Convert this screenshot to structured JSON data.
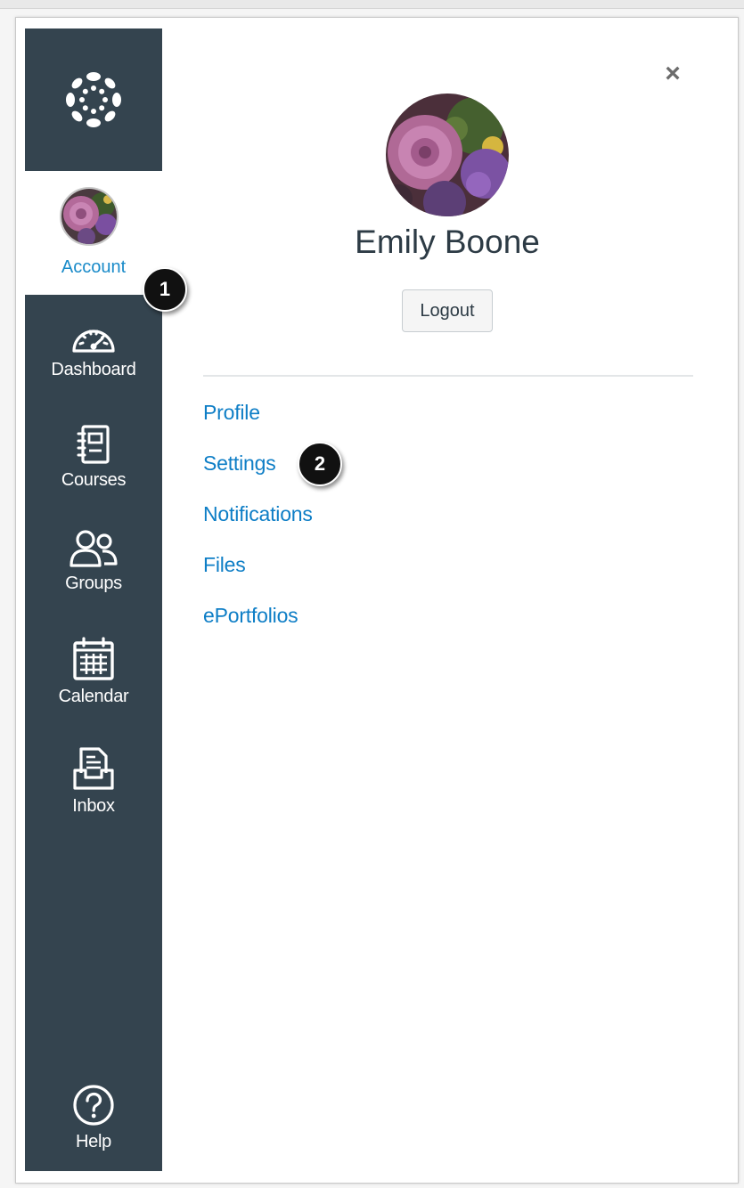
{
  "nav": {
    "account_label": "Account",
    "items": [
      {
        "label": "Dashboard",
        "icon": "dashboard-icon"
      },
      {
        "label": "Courses",
        "icon": "courses-icon"
      },
      {
        "label": "Groups",
        "icon": "groups-icon"
      },
      {
        "label": "Calendar",
        "icon": "calendar-icon"
      },
      {
        "label": "Inbox",
        "icon": "inbox-icon"
      }
    ],
    "help_label": "Help"
  },
  "tray": {
    "close_symbol": "×",
    "user_name": "Emily Boone",
    "logout_label": "Logout",
    "links": [
      "Profile",
      "Settings",
      "Notifications",
      "Files",
      "ePortfolios"
    ]
  },
  "callouts": {
    "first": "1",
    "second": "2"
  },
  "colors": {
    "nav_bg": "#34444f",
    "link": "#0e7ec6",
    "account_label": "#1a8bc9",
    "badge_bg": "#111111"
  }
}
